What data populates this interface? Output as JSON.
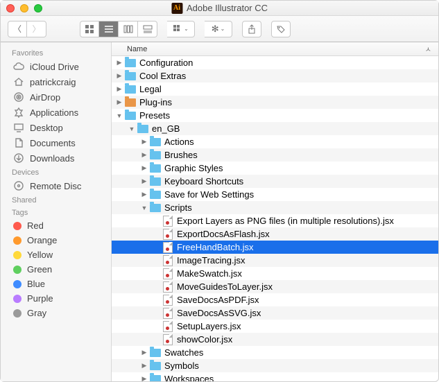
{
  "window": {
    "title": "Adobe Illustrator CC"
  },
  "columns": {
    "name": "Name"
  },
  "sidebar": {
    "sections": [
      {
        "title": "Favorites",
        "items": [
          {
            "label": "iCloud Drive",
            "icon": "cloud-icon"
          },
          {
            "label": "patrickcraig",
            "icon": "home-icon"
          },
          {
            "label": "AirDrop",
            "icon": "airdrop-icon"
          },
          {
            "label": "Applications",
            "icon": "apps-icon"
          },
          {
            "label": "Desktop",
            "icon": "desktop-icon"
          },
          {
            "label": "Documents",
            "icon": "documents-icon"
          },
          {
            "label": "Downloads",
            "icon": "downloads-icon"
          }
        ]
      },
      {
        "title": "Devices",
        "items": [
          {
            "label": "Remote Disc",
            "icon": "disc-icon"
          }
        ]
      },
      {
        "title": "Shared",
        "items": []
      },
      {
        "title": "Tags",
        "items": [
          {
            "label": "Red",
            "color": "#ff5a4d"
          },
          {
            "label": "Orange",
            "color": "#ff9a2e"
          },
          {
            "label": "Yellow",
            "color": "#ffd93b"
          },
          {
            "label": "Green",
            "color": "#5fcf5f"
          },
          {
            "label": "Blue",
            "color": "#3f8cff"
          },
          {
            "label": "Purple",
            "color": "#b97cff"
          },
          {
            "label": "Gray",
            "color": "#9a9a9a"
          }
        ]
      }
    ]
  },
  "tree": [
    {
      "depth": 0,
      "expanded": false,
      "kind": "folder",
      "label": "Configuration"
    },
    {
      "depth": 0,
      "expanded": false,
      "kind": "folder",
      "label": "Cool Extras"
    },
    {
      "depth": 0,
      "expanded": false,
      "kind": "folder",
      "label": "Legal"
    },
    {
      "depth": 0,
      "expanded": false,
      "kind": "folder-orange",
      "label": "Plug-ins"
    },
    {
      "depth": 0,
      "expanded": true,
      "kind": "folder",
      "label": "Presets"
    },
    {
      "depth": 1,
      "expanded": true,
      "kind": "folder",
      "label": "en_GB"
    },
    {
      "depth": 2,
      "expanded": false,
      "kind": "folder",
      "label": "Actions"
    },
    {
      "depth": 2,
      "expanded": false,
      "kind": "folder",
      "label": "Brushes"
    },
    {
      "depth": 2,
      "expanded": false,
      "kind": "folder",
      "label": "Graphic Styles"
    },
    {
      "depth": 2,
      "expanded": false,
      "kind": "folder",
      "label": "Keyboard Shortcuts"
    },
    {
      "depth": 2,
      "expanded": false,
      "kind": "folder",
      "label": "Save for Web Settings"
    },
    {
      "depth": 2,
      "expanded": true,
      "kind": "folder",
      "label": "Scripts"
    },
    {
      "depth": 3,
      "expanded": null,
      "kind": "jsx",
      "label": "Export Layers as PNG files (in multiple resolutions).jsx"
    },
    {
      "depth": 3,
      "expanded": null,
      "kind": "jsx",
      "label": "ExportDocsAsFlash.jsx"
    },
    {
      "depth": 3,
      "expanded": null,
      "kind": "jsx",
      "label": "FreeHandBatch.jsx",
      "selected": true
    },
    {
      "depth": 3,
      "expanded": null,
      "kind": "jsx",
      "label": "ImageTracing.jsx"
    },
    {
      "depth": 3,
      "expanded": null,
      "kind": "jsx",
      "label": "MakeSwatch.jsx"
    },
    {
      "depth": 3,
      "expanded": null,
      "kind": "jsx",
      "label": "MoveGuidesToLayer.jsx"
    },
    {
      "depth": 3,
      "expanded": null,
      "kind": "jsx",
      "label": "SaveDocsAsPDF.jsx"
    },
    {
      "depth": 3,
      "expanded": null,
      "kind": "jsx",
      "label": "SaveDocsAsSVG.jsx"
    },
    {
      "depth": 3,
      "expanded": null,
      "kind": "jsx",
      "label": "SetupLayers.jsx"
    },
    {
      "depth": 3,
      "expanded": null,
      "kind": "jsx",
      "label": "showColor.jsx"
    },
    {
      "depth": 2,
      "expanded": false,
      "kind": "folder",
      "label": "Swatches"
    },
    {
      "depth": 2,
      "expanded": false,
      "kind": "folder",
      "label": "Symbols"
    },
    {
      "depth": 2,
      "expanded": false,
      "kind": "folder",
      "label": "Workspaces"
    }
  ]
}
